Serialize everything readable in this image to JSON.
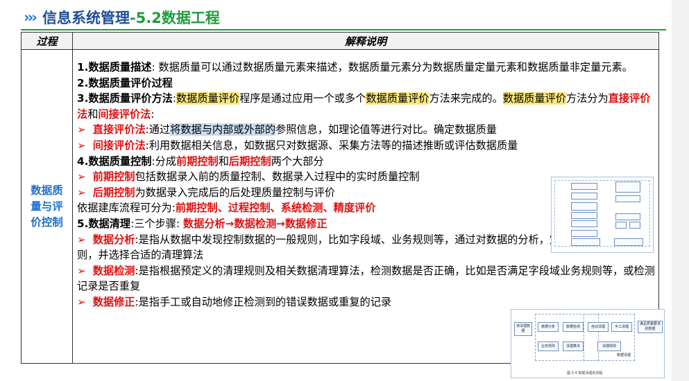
{
  "header": {
    "title_main": "信息系统管理",
    "title_sub": "-5.2数据工程",
    "chevron": "›››"
  },
  "table": {
    "col1_header": "过程",
    "col2_header": "解释说明",
    "row_label_lines": [
      "数据质",
      "量与评",
      "价控制"
    ]
  },
  "content": {
    "l1_bold": "1.数据质量描述",
    "l1_text": ": 数据质量可以通过数据质量元素来描述，数据质量元素分为数据质量定量元素和数据质量非定量元素。",
    "l2_bold": "2.数据质量评价过程",
    "l3_bold": "3.数据质量评价方法",
    "l3_colon": ":",
    "l3_hl1": "数据质量评价",
    "l3_t1": "程序是通过应用一个或多个",
    "l3_hl2": "数据质量评价",
    "l3_t2": "方法来完成的。",
    "l3_hl3": "数据质量评价",
    "l3_t3": "方法分为",
    "l3_r1": "直接评价法",
    "l3_and": "和",
    "l3_r2": "间接评价法",
    "l3_end": ":",
    "bullet": "➢",
    "d1_red": "直接评价法",
    "d1_t1": ":通过",
    "d1_sel": "将数据与内部或外部的",
    "d1_t2": "参照信息，如理论值等进行对比。确定数据质量",
    "d2_red": "间接评价法",
    "d2_t": ":利用数据相关信息，如数据只对数据源、采集方法等的描述推断或评估数据质量",
    "l4_bold": "4.数据质量控制",
    "l4_t1": ":分成",
    "l4_r1": "前期控制",
    "l4_and": "和",
    "l4_r2": "后期控制",
    "l4_t2": "两个大部分",
    "c1_red": "前期控制",
    "c1_t": "包括数据录入前的质量控制、数据录入过程中的实时质量控制",
    "c2_red": "后期控制",
    "c2_t": "为数据录入完成后的后处理质量控制与评价",
    "l5_t": "依据建库流程可分为:",
    "l5_red": "前期控制、过程控制、系统检测、精度评价",
    "l6_bold": "5.数据清理",
    "l6_t": ":三个步骤: ",
    "l6_red": "数据分析→数据检测→数据修正",
    "e1_red": "数据分析",
    "e1_t": ":是指从数据中发现控制数据的一般规则，比如字段域、业务规则等，通过对数据的分析，定义出数据清理的规则，并选择合适的清理算法",
    "e2_red": "数据检测",
    "e2_t": ":是指根据预定义的清理规则及相关数据清理算法，检测数据是否正确，比如是否满足字段域业务规则等，或检测记录是否重复",
    "e3_red": "数据修正",
    "e3_t": ":是指手工或自动地修正检测到的错误数据或重复的记录"
  },
  "figure2": {
    "boxes": [
      "待清理数据",
      "数据分析",
      "数据检测",
      "自动清理",
      "手工清理",
      "满足质量要求的数据",
      "业务规则",
      "清理算法",
      "清理规则",
      "数据清理"
    ],
    "caption": "图 5-4  数据清理的流程"
  },
  "colors": {
    "title_blue": "#1f4e9a",
    "title_green": "#1e9e3a",
    "label_blue": "#1e6fd0",
    "emphasis_red": "#e01010",
    "highlight_yellow": "#fbe67a",
    "selection_blue": "#c9ddf0"
  }
}
